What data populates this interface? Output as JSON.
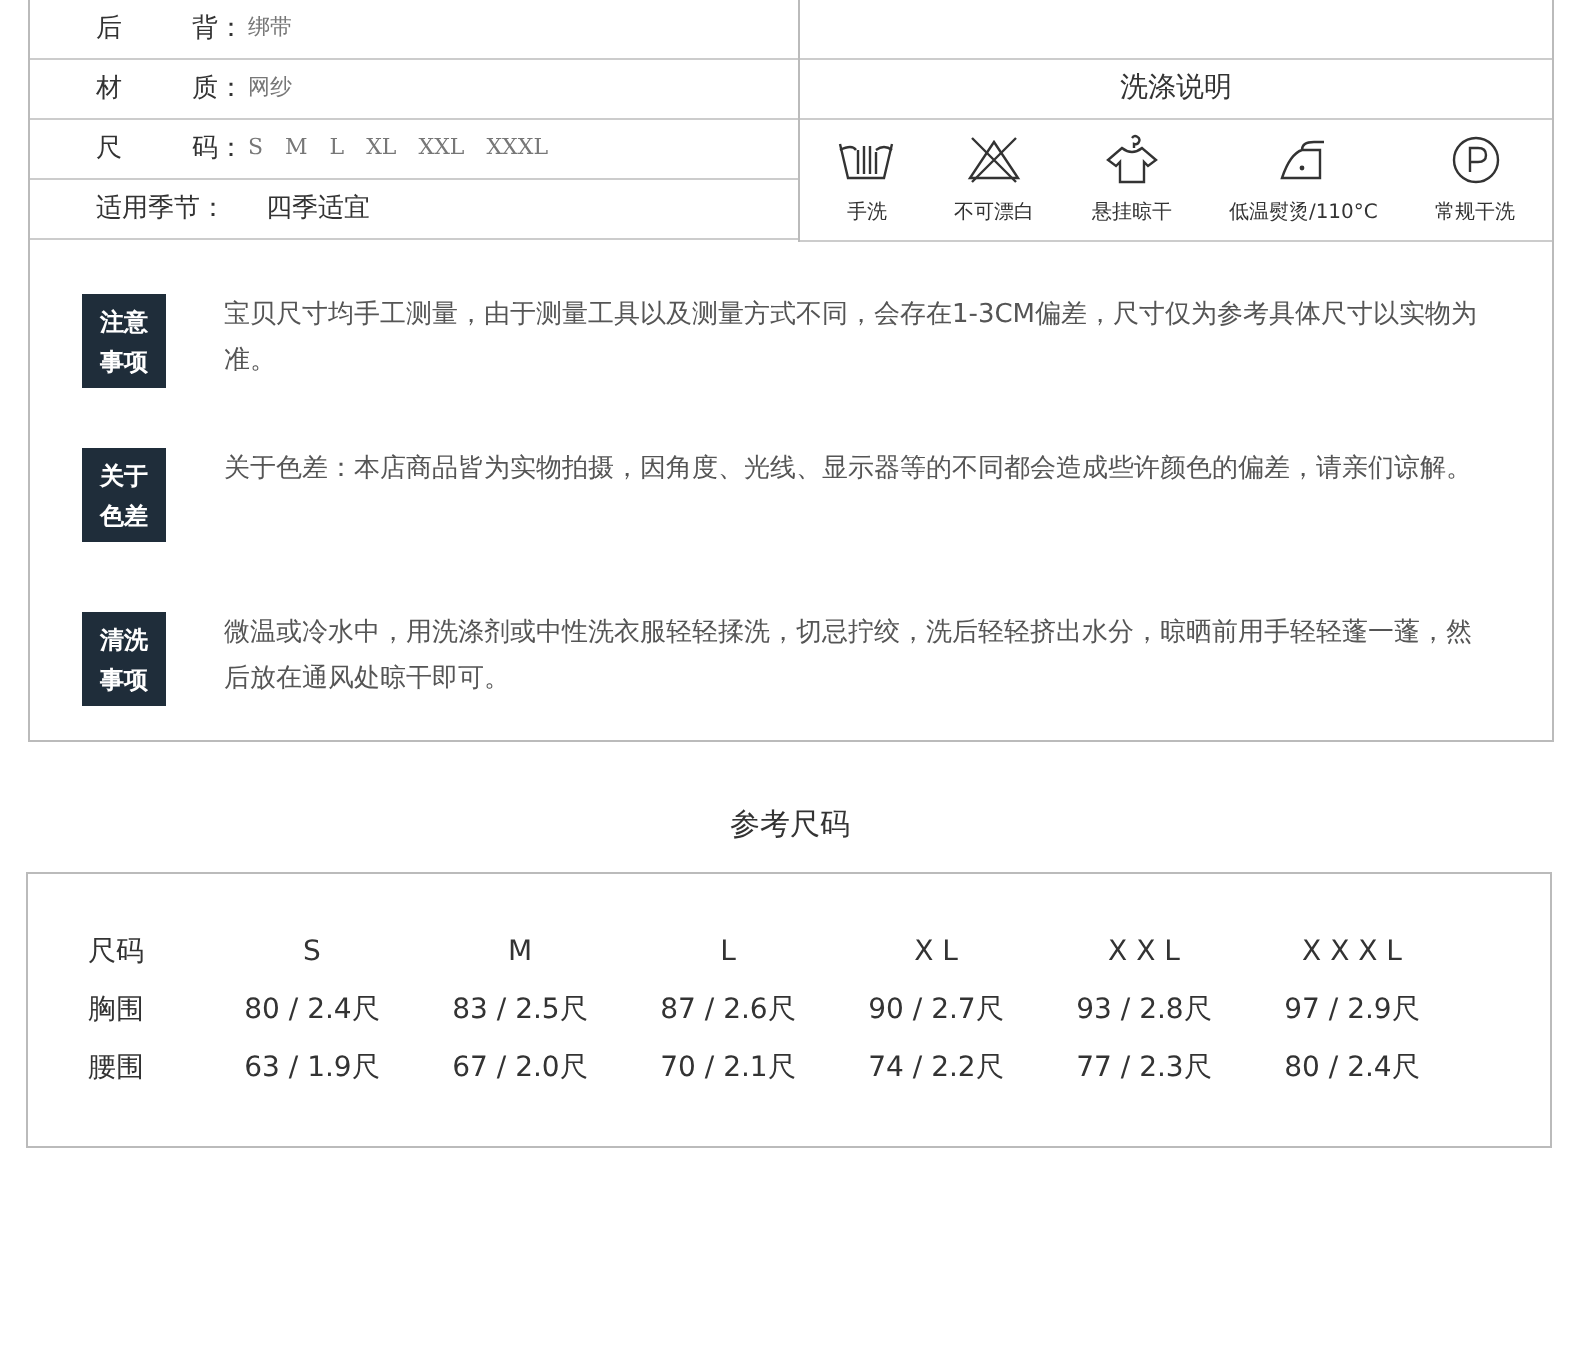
{
  "spec_rows": [
    {
      "label": "后",
      "label_2": "背：",
      "value": "绑带"
    },
    {
      "label": "材",
      "label_2": "质：",
      "value": "网纱"
    },
    {
      "label": "尺",
      "label_2": "码：",
      "value": "S　M　L　XL　XXL　XXXL"
    },
    {
      "label": "适用季节：",
      "value": "四季适宜"
    }
  ],
  "wash": {
    "title": "洗涤说明",
    "items": [
      {
        "kind": "handwash",
        "label": "手洗"
      },
      {
        "kind": "nobleach",
        "label": "不可漂白"
      },
      {
        "kind": "hang",
        "label": "悬挂晾干"
      },
      {
        "kind": "iron",
        "label": "低温熨烫/110°C"
      },
      {
        "kind": "dryclean",
        "label": "常规干洗"
      }
    ]
  },
  "notes": [
    {
      "tag": "注意事项",
      "text": "宝贝尺寸均手工测量，由于测量工具以及测量方式不同，会存在1-3CM偏差，尺寸仅为参考具体尺寸以实物为准。"
    },
    {
      "tag": "关于色差",
      "text": "关于色差：本店商品皆为实物拍摄，因角度、光线、显示器等的不同都会造成些许颜色的偏差，请亲们谅解。"
    },
    {
      "tag": "清洗事项",
      "text": "微温或冷水中，用洗涤剂或中性洗衣服轻轻揉洗，切忌拧绞，洗后轻轻挤出水分，晾晒前用手轻轻蓬一蓬，然后放在通风处晾干即可。"
    }
  ],
  "size_table": {
    "title": "参考尺码",
    "columns": [
      "尺码",
      "S",
      "M",
      "L",
      "X L",
      "X X L",
      "X X X L"
    ],
    "rows": [
      [
        "胸围",
        "80 / 2.4尺",
        "83 / 2.5尺",
        "87 / 2.6尺",
        "90 / 2.7尺",
        "93 / 2.8尺",
        "97 / 2.9尺"
      ],
      [
        "腰围",
        "63 / 1.9尺",
        "67 / 2.0尺",
        "70 / 2.1尺",
        "74 / 2.2尺",
        "77 / 2.3尺",
        "80 / 2.4尺"
      ]
    ]
  }
}
